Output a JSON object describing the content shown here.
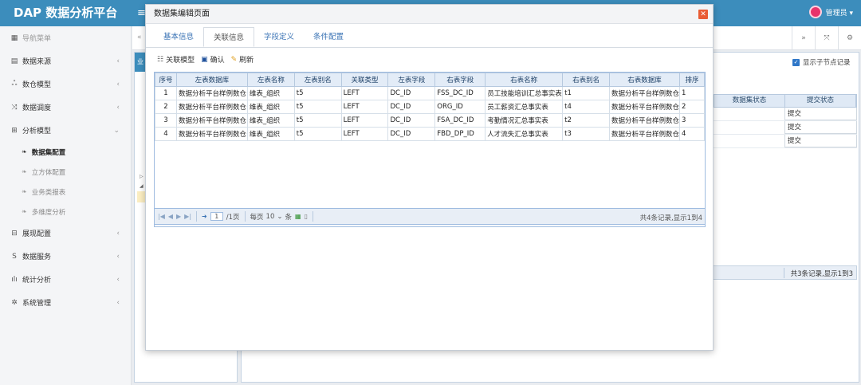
{
  "app": {
    "title": "DAP 数据分析平台",
    "toggle": "≡",
    "user": "管理员 ▾"
  },
  "sidebar": {
    "header": "导航菜单",
    "items": [
      {
        "label": "数据来源",
        "icon": "▤"
      },
      {
        "label": "数仓模型",
        "icon": "ஃ"
      },
      {
        "label": "数据调度",
        "icon": "⤨"
      },
      {
        "label": "分析模型",
        "icon": "⊞"
      }
    ],
    "subitems": [
      {
        "label": "数据集配置"
      },
      {
        "label": "立方体配置"
      },
      {
        "label": "业务类报表"
      },
      {
        "label": "多维度分析"
      }
    ],
    "items2": [
      {
        "label": "展现配置",
        "icon": "⊟"
      },
      {
        "label": "数据服务",
        "icon": "S"
      },
      {
        "label": "统计分析",
        "icon": "ılı"
      },
      {
        "label": "系统管理",
        "icon": "✲"
      }
    ]
  },
  "main": {
    "tab_stub": "业",
    "show_child": "显示子节点记录",
    "bg_table": {
      "headers": [
        "数据集状态",
        "提交状态"
      ],
      "rows": [
        [
          "",
          "提交"
        ],
        [
          "",
          "提交"
        ],
        [
          "",
          "提交"
        ]
      ]
    },
    "bg_total": "共3条记录,显示1到3"
  },
  "modal": {
    "title": "数据集编辑页面",
    "tabs": [
      "基本信息",
      "关联信息",
      "字段定义",
      "条件配置"
    ],
    "toolbar": {
      "relate": "关联模型",
      "confirm": "确认",
      "refresh": "刷新"
    },
    "columns": [
      "序号",
      "左表数据库",
      "左表名称",
      "左表别名",
      "关联类型",
      "左表字段",
      "右表字段",
      "右表名称",
      "右表别名",
      "右表数据库",
      "排序"
    ],
    "rows": [
      [
        "1",
        "数据分析平台样例数仓",
        "维表_组织",
        "t5",
        "LEFT",
        "DC_ID",
        "FSS_DC_ID",
        "员工技能培训汇总事实表",
        "t1",
        "数据分析平台样例数仓",
        "1"
      ],
      [
        "2",
        "数据分析平台样例数仓",
        "维表_组织",
        "t5",
        "LEFT",
        "DC_ID",
        "ORG_ID",
        "员工薪资汇总事实表",
        "t4",
        "数据分析平台样例数仓",
        "2"
      ],
      [
        "3",
        "数据分析平台样例数仓",
        "维表_组织",
        "t5",
        "LEFT",
        "DC_ID",
        "FSA_DC_ID",
        "考勤情况汇总事实表",
        "t2",
        "数据分析平台样例数仓",
        "3"
      ],
      [
        "4",
        "数据分析平台样例数仓",
        "维表_组织",
        "t5",
        "LEFT",
        "DC_ID",
        "FBD_DP_ID",
        "人才流失汇总事实表",
        "t3",
        "数据分析平台样例数仓",
        "4"
      ]
    ],
    "pager": {
      "page": "1",
      "of": "/1页",
      "per_page_label": "每页",
      "per_page": "10",
      "unit": "条",
      "total": "共4条记录,显示1到4"
    }
  }
}
